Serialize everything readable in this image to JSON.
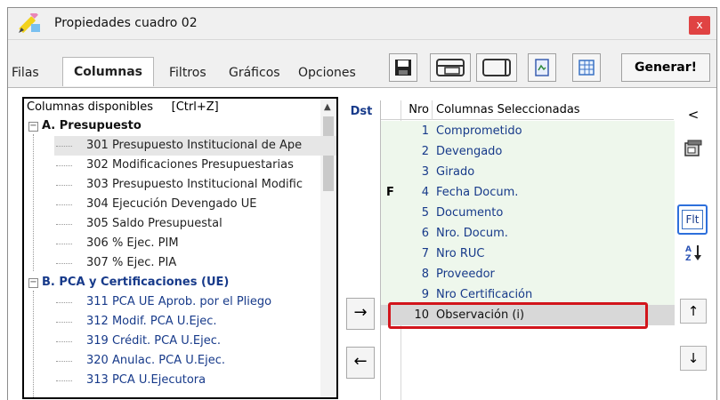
{
  "window": {
    "title": "Propiedades cuadro 02",
    "close_label": "x"
  },
  "tabs": [
    {
      "label": "Filas"
    },
    {
      "label": "Columnas"
    },
    {
      "label": "Filtros"
    },
    {
      "label": "Gráficos"
    },
    {
      "label": "Opciones"
    }
  ],
  "toolbar": {
    "icons": [
      "save-icon",
      "layout-split-icon",
      "layout-single-icon",
      "document-icon",
      "grid-icon"
    ],
    "generate_label": "Generar!"
  },
  "available_columns": {
    "header": "Columnas disponibles     [Ctrl+Z]",
    "groups": [
      {
        "label": "A. Presupuesto",
        "expander": "−",
        "items": [
          {
            "label": "301 Presupuesto Institucional de Ape"
          },
          {
            "label": "302 Modificaciones Presupuestarias"
          },
          {
            "label": "303 Presupuesto Institucional Modific"
          },
          {
            "label": "304 Ejecución Devengado UE"
          },
          {
            "label": "305 Saldo Presupuestal"
          },
          {
            "label": "306 % Ejec. PIM"
          },
          {
            "label": "307 % Ejec. PIA"
          }
        ]
      },
      {
        "label": "B. PCA y Certificaciones (UE)",
        "expander": "−",
        "items": [
          {
            "label": "311 PCA UE Aprob. por el Pliego"
          },
          {
            "label": "312 Modif. PCA U.Ejec."
          },
          {
            "label": "319 Crédit. PCA U.Ejec."
          },
          {
            "label": "320 Anulac. PCA U.Ejec."
          },
          {
            "label": "313 PCA U.Ejecutora"
          }
        ]
      }
    ]
  },
  "dst_label": "Dst",
  "move_buttons": {
    "add": "→",
    "remove": "←"
  },
  "selected_columns": {
    "header_no": "Nro",
    "header_name": "Columnas Seleccionadas",
    "rows": [
      {
        "flag": "",
        "no": "1",
        "name": "Comprometido"
      },
      {
        "flag": "",
        "no": "2",
        "name": "Devengado"
      },
      {
        "flag": "",
        "no": "3",
        "name": "Girado"
      },
      {
        "flag": "F",
        "no": "4",
        "name": "Fecha Docum."
      },
      {
        "flag": "",
        "no": "5",
        "name": "Documento"
      },
      {
        "flag": "",
        "no": "6",
        "name": "Nro. Docum."
      },
      {
        "flag": "",
        "no": "7",
        "name": "Nro RUC"
      },
      {
        "flag": "",
        "no": "8",
        "name": "Proveedor"
      },
      {
        "flag": "",
        "no": "9",
        "name": "Nro Certificación"
      },
      {
        "flag": "",
        "no": "10",
        "name": "Observación (i)"
      }
    ]
  },
  "side_buttons": {
    "back": "<",
    "filter": "Flt",
    "sort_icon": "sort-az-icon",
    "up": "↑",
    "down": "↓"
  },
  "colors": {
    "highlight_red": "#d2151c",
    "highlight_blue": "#2d6fdb",
    "list_bg": "#eef7ec",
    "text_blue": "#173a8a"
  }
}
